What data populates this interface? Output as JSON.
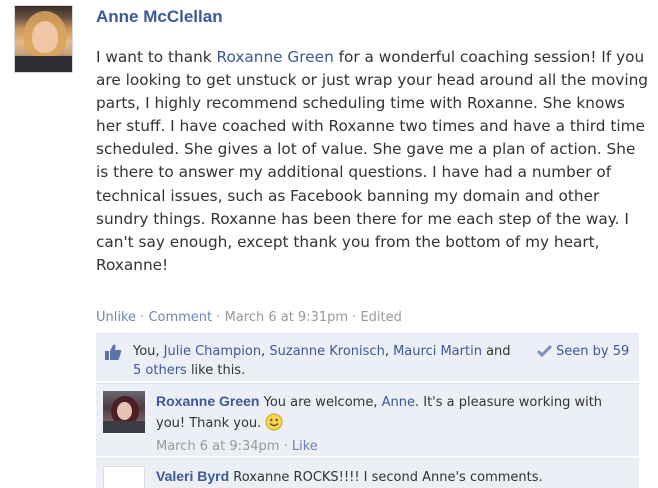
{
  "post": {
    "author": "Anne McClellan",
    "text_parts": {
      "p1": "I want to thank ",
      "mention": "Roxanne Green",
      "p2": " for a wonderful coaching session! If you are looking to get unstuck or just wrap your head around all the moving parts, I highly recommend scheduling time with Roxanne. She knows her stuff. I have coached with Roxanne two times and have a third time scheduled. She gives a lot of value. She gave me a plan of action. She is there to answer my additional questions. I have had a number of technical issues, such as Facebook banning my domain and other sundry things. Roxanne has been there for me each step of the way. I can't say enough, except thank you from the bottom of my heart, Roxanne!"
    },
    "actions": {
      "unlike": "Unlike",
      "comment": "Comment",
      "timestamp": "March 6 at 9:31pm",
      "edited": "Edited",
      "separator": " · "
    }
  },
  "likes": {
    "icon": "thumbs-up-icon",
    "prefix": "You, ",
    "names": [
      "Julie Champion",
      "Suzanne Kronisch",
      "Maurci Martin"
    ],
    "conj": " and ",
    "others": "5 others",
    "suffix": " like this.",
    "seen_icon": "checkmark-icon",
    "seen": "Seen by 59"
  },
  "comments": [
    {
      "author": "Roxanne Green",
      "text_before": " You are welcome, ",
      "mention": "Anne",
      "text_after": ". It's a pleasure working with you! Thank you.",
      "emoji": "smiley-icon",
      "timestamp": "March 6 at 9:34pm",
      "like": "Like"
    },
    {
      "author": "Valeri Byrd",
      "text": " Roxanne ROCKS!!!! I second Anne's comments."
    }
  ],
  "colors": {
    "link": "#3b5998",
    "muted": "#999999",
    "panel": "#eceff5"
  }
}
